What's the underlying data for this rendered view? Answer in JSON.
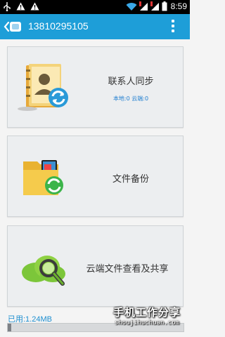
{
  "status_bar": {
    "time": "8:59",
    "icons": [
      "usb-icon",
      "warning-icon",
      "warning-icon",
      "wifi-icon",
      "sim1-signal-icon",
      "sim2-signal-icon",
      "battery-icon"
    ]
  },
  "app_bar": {
    "title": "13810295105",
    "back_icon": "back-arrow-icon",
    "menu_icon": "overflow-menu-icon"
  },
  "cards": [
    {
      "title": "联系人同步",
      "subtitle": "本地:0  云端:0",
      "icon": "contacts-sync-icon"
    },
    {
      "title": "文件备份",
      "icon": "file-backup-icon"
    },
    {
      "title": "云端文件查看及共享",
      "icon": "cloud-search-icon"
    }
  ],
  "storage": {
    "label": "已用:1.24MB",
    "used_fraction": 0.02
  },
  "watermark": {
    "line1": "手机工作分享",
    "line2": "shoujihuchuan.com"
  },
  "colors": {
    "app_bar": "#1e9ed8",
    "card_bg": "#eceef0",
    "accent_text": "#1e8fd0"
  }
}
